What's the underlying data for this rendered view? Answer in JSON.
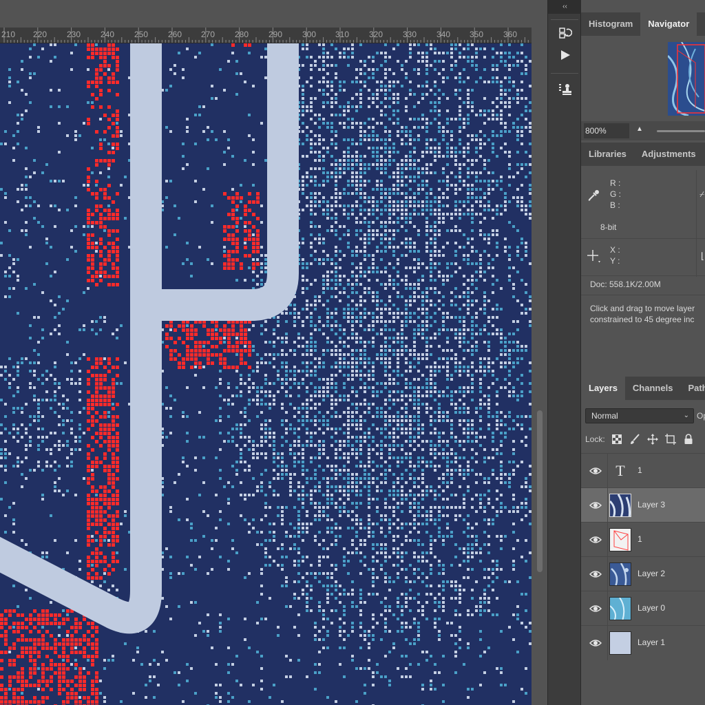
{
  "ruler": {
    "ticks": [
      "210",
      "220",
      "230",
      "240",
      "250",
      "260",
      "270",
      "280",
      "290",
      "300",
      "310",
      "320",
      "330",
      "340",
      "350",
      "360"
    ]
  },
  "dock": {
    "collapse_label": "‹‹"
  },
  "navigator": {
    "tabs": [
      {
        "label": "Histogram",
        "active": false
      },
      {
        "label": "Navigator",
        "active": true
      }
    ],
    "zoom": "800%"
  },
  "info": {
    "tabs": [
      {
        "label": "Libraries",
        "active": false
      },
      {
        "label": "Adjustments",
        "active": false
      }
    ],
    "r_label": "R :",
    "g_label": "G :",
    "b_label": "B :",
    "bit_depth": "8-bit",
    "x_label": "X :",
    "y_label": "Y :",
    "doc": "Doc: 558.1K/2.00M",
    "hint_line1": "Click and drag to move layer",
    "hint_line2": "constrained to 45 degree inc"
  },
  "layers_panel": {
    "tabs": [
      {
        "label": "Layers",
        "active": true
      },
      {
        "label": "Channels",
        "active": false
      },
      {
        "label": "Path",
        "active": false
      }
    ],
    "blend_mode": "Normal",
    "opacity_label": "Op",
    "lock_label": "Lock:",
    "layers": [
      {
        "name": "1",
        "kind": "text",
        "selected": false
      },
      {
        "name": "Layer 3",
        "kind": "pattern-dark",
        "selected": true
      },
      {
        "name": "1",
        "kind": "outline",
        "selected": false
      },
      {
        "name": "Layer 2",
        "kind": "pattern-blue",
        "selected": false
      },
      {
        "name": "Layer 0",
        "kind": "pattern-light",
        "selected": false
      },
      {
        "name": "Layer 1",
        "kind": "solid",
        "selected": false
      }
    ]
  },
  "colors": {
    "canvas_bg": "#213063",
    "dither_light": "#c4cfe3",
    "dither_cyan": "#4aa0c8",
    "highlight_red": "#ff2a2a",
    "shape_stroke": "#bfcbe0",
    "panel_bg": "#535353",
    "tab_bg": "#424242"
  }
}
